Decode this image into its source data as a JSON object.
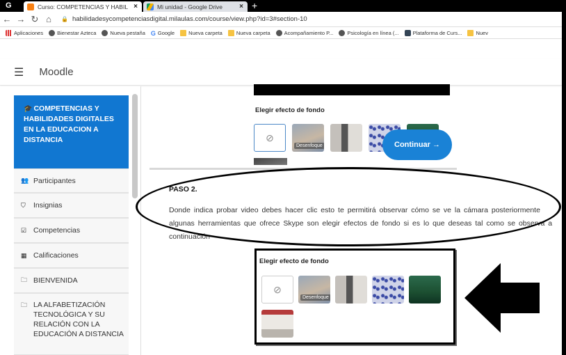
{
  "browser": {
    "tabs": [
      {
        "label": "Curso: COMPETENCIAS Y HABIL",
        "close": "×"
      },
      {
        "label": "Mi unidad - Google Drive",
        "close": "×"
      }
    ],
    "new_tab": "+",
    "left_letter": "G",
    "url": "habilidadesycompetenciasdigital.milaulas.com/course/view.php?id=3#section-10",
    "bookmarks": [
      "Aplicaciones",
      "Bienestar Azteca",
      "Nueva pestaña",
      "Google",
      "Nueva carpeta",
      "Nueva carpeta",
      "Acompañamiento P...",
      "Psicología en línea (...",
      "Plataforma de Curs...",
      "Nuev"
    ]
  },
  "moodle": {
    "title": "Moodle"
  },
  "sidebar": {
    "course_title": "COMPETENCIAS Y HABILIDADES DIGITALES EN LA EDUCACION A DISTANCIA",
    "items": [
      {
        "label": "Participantes",
        "icon": "users-icon"
      },
      {
        "label": "Insignias",
        "icon": "shield-icon"
      },
      {
        "label": "Competencias",
        "icon": "check-square-icon"
      },
      {
        "label": "Calificaciones",
        "icon": "table-icon"
      },
      {
        "label": "BIENVENIDA",
        "icon": "folder-icon"
      },
      {
        "label": "LA ALFABETIZACIÓN TECNOLÓGICA Y SU RELACIÓN CON LA EDUCACIÓN A DISTANCIA",
        "icon": "folder-icon"
      }
    ]
  },
  "content": {
    "bg_heading_top": "Elegir efecto de fondo",
    "blur_label": "Desenfoque",
    "none_symbol": "⊘",
    "continuar": "Continuar →",
    "paso": "PASO 2.",
    "paragraph": "Donde indica probar video debes hacer clic esto te permitirá observar cómo se  ve la  cámara posteriormente  algunas herramientas  que  ofrece  Skype son elegir  efectos de fondo si es lo que deseas  tal como se  observa  a continuación",
    "bg_heading_panel": "Elegir efecto de fondo"
  },
  "colors": {
    "moodle_blue": "#1177d1",
    "button_blue": "#1a82d6"
  }
}
